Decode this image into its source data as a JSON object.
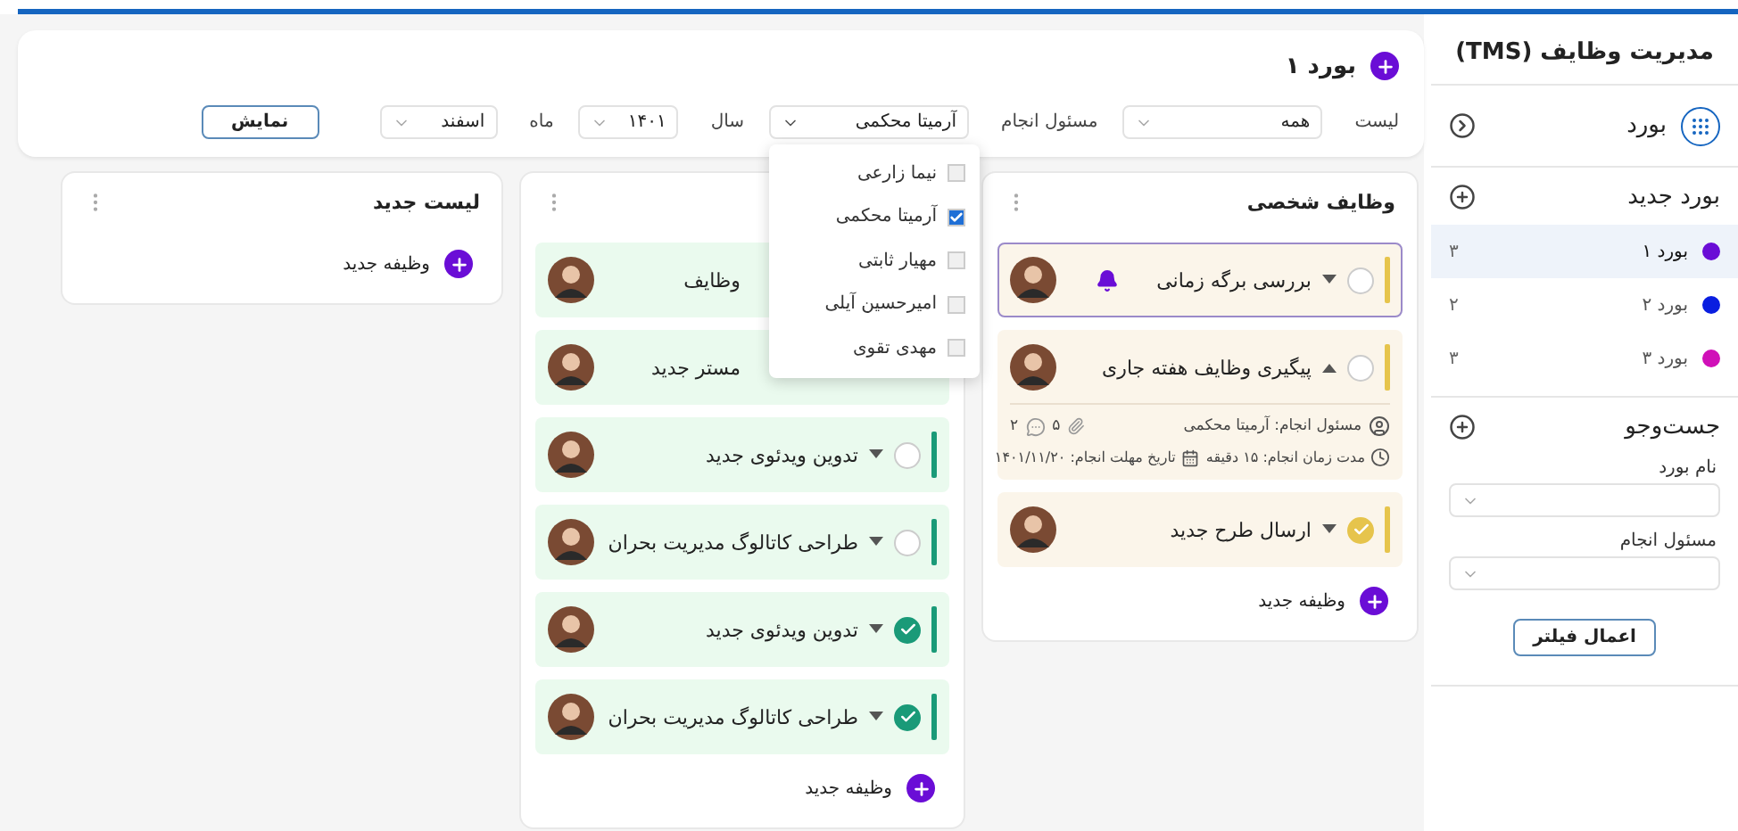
{
  "sidebar": {
    "title": "مدیریت وظایف (TMS)",
    "board_header": "بورد",
    "new_board": "بورد جدید",
    "boards": [
      {
        "name": "بورد ۱",
        "count": "۳",
        "color": "#6a0dd6",
        "selected": true
      },
      {
        "name": "بورد ۲",
        "count": "۲",
        "color": "#0a1ee0",
        "selected": false
      },
      {
        "name": "بورد ۳",
        "count": "۳",
        "color": "#d010b8",
        "selected": false
      }
    ],
    "search": {
      "title": "جست‌وجو",
      "fields": [
        {
          "label": "نام بورد"
        },
        {
          "label": "مسئول انجام"
        }
      ],
      "button": "اعمال فیلتر"
    }
  },
  "header": {
    "title": "بورد ۱",
    "filters": [
      {
        "label": "لیست",
        "value": "همه",
        "expanded": false
      },
      {
        "label": "مسئول انجام",
        "value": "آرمیتا محکمی",
        "expanded": true,
        "options": [
          {
            "label": "نیما زارعی",
            "checked": false
          },
          {
            "label": "آرمیتا محکمی",
            "checked": true
          },
          {
            "label": "مهیار ثابتی",
            "checked": false
          },
          {
            "label": "امیرحسین آیلی",
            "checked": false
          },
          {
            "label": "مهدی تقوی",
            "checked": false
          }
        ]
      },
      {
        "label": "سال",
        "value": "۱۴۰۱",
        "expanded": false
      },
      {
        "label": "ماه",
        "value": "اسفند",
        "expanded": false
      }
    ],
    "button": "نمایش"
  },
  "lists": [
    {
      "title": "وظایف شخصی",
      "color": "#e6c44c",
      "add_label": "وظیفه جدید",
      "tasks": [
        {
          "title": "بررسی برگه زمانی",
          "done": false,
          "expanded": false,
          "selected": true,
          "alert": true
        },
        {
          "title": "پیگیری وظایف هفته جاری",
          "done": false,
          "expanded": true,
          "selected": false,
          "alert": false,
          "details": {
            "assignee": "مسئول انجام: آرمیتا محکمی",
            "attachments": "۵",
            "comments": "۲",
            "duration": "مدت زمان انجام: ۱۵ دقیقه",
            "deadline": "تاریخ مهلت انجام: ۱۴۰۱/۱۱/۲۰"
          }
        },
        {
          "title": "ارسال طرح جدید",
          "done": true,
          "expanded": false,
          "selected": false,
          "alert": false
        }
      ]
    },
    {
      "color": "#1a9a78",
      "add_label": "وظیفه جدید",
      "tasks": [
        {
          "title": "وظایف"
        },
        {
          "title": "مستر جدید"
        },
        {
          "title": "تدوین ویدئوی جدید",
          "done": false,
          "expanded": false,
          "selected": false,
          "alert": false
        },
        {
          "title": "طراحی کاتالوگ مدیریت بحران",
          "done": false,
          "expanded": false,
          "selected": false,
          "alert": false
        },
        {
          "title": "تدوین ویدئوی جدید",
          "done": true,
          "expanded": false,
          "selected": false,
          "alert": false
        },
        {
          "title": "طراحی کاتالوگ مدیریت بحران",
          "done": true,
          "expanded": false,
          "selected": false,
          "alert": false
        }
      ]
    },
    {
      "title": "لیست جدید",
      "add_label": "وظیفه جدید"
    }
  ]
}
